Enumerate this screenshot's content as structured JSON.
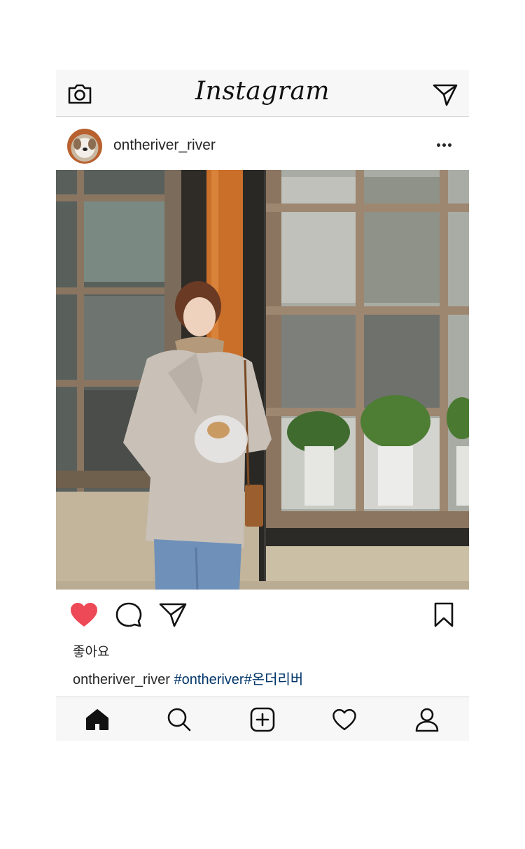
{
  "app": {
    "logo": "Instagram"
  },
  "post": {
    "username": "ontheriver_river",
    "likes_label": "좋아요",
    "caption_user": "ontheriver_river",
    "caption_tags": "#ontheriver#온더리버",
    "liked": true
  },
  "icons": {
    "top_left": "camera-icon",
    "top_right": "direct-message-icon",
    "post_menu": "more-options-icon",
    "like": "heart-filled-icon",
    "comment": "comment-icon",
    "share": "send-icon",
    "save": "bookmark-icon",
    "nav": [
      "home-icon",
      "search-icon",
      "add-post-icon",
      "activity-heart-icon",
      "profile-icon"
    ]
  },
  "colors": {
    "like_red": "#ed4956",
    "hashtag_blue": "#003569",
    "bar_bg": "#f7f7f7"
  }
}
